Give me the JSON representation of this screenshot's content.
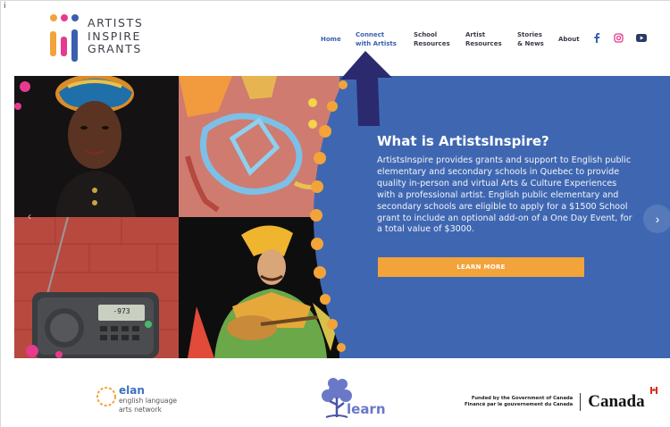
{
  "corner_mark": "i",
  "logo": {
    "lines": [
      "ARTISTS",
      "INSPIRE",
      "GRANTS"
    ]
  },
  "nav": {
    "items": [
      {
        "line1": "Home",
        "line2": ""
      },
      {
        "line1": "Connect",
        "line2": "with Artists"
      },
      {
        "line1": "School",
        "line2": "Resources"
      },
      {
        "line1": "Artist",
        "line2": "Resources"
      },
      {
        "line1": "Stories",
        "line2": "& News"
      },
      {
        "line1": "About",
        "line2": ""
      }
    ],
    "social": [
      "facebook-icon",
      "instagram-icon",
      "youtube-icon"
    ]
  },
  "hero": {
    "title": "What is ArtistsInspire?",
    "body": "ArtistsInspire provides grants and support to English public elementary and secondary schools in Quebec to provide quality in-person and virtual Arts & Culture Experiences with a professional artist. English public elementary and secondary schools are eligible to apply for a $1500 School grant to include an optional add-on of a One Day Event, for a total value of $3000.",
    "button_label": "LEARN MORE",
    "radio_display": "-973",
    "next_icon": "chevron-right-icon",
    "prev_icon": "chevron-left-icon"
  },
  "footer": {
    "elan_name": "elan",
    "elan_sub": [
      "english language",
      "arts network"
    ],
    "learn_word": "learn",
    "canada_funded": [
      "Funded by the Government of Canada",
      "Financé par le gouvernement du Canada"
    ],
    "canada_word": "Canada"
  },
  "colors": {
    "hero_blue": "#3f67b1",
    "accent_orange": "#f2a33a",
    "nav_blue": "#3b5fb0",
    "annotation_arrow": "#2b2a6e"
  }
}
